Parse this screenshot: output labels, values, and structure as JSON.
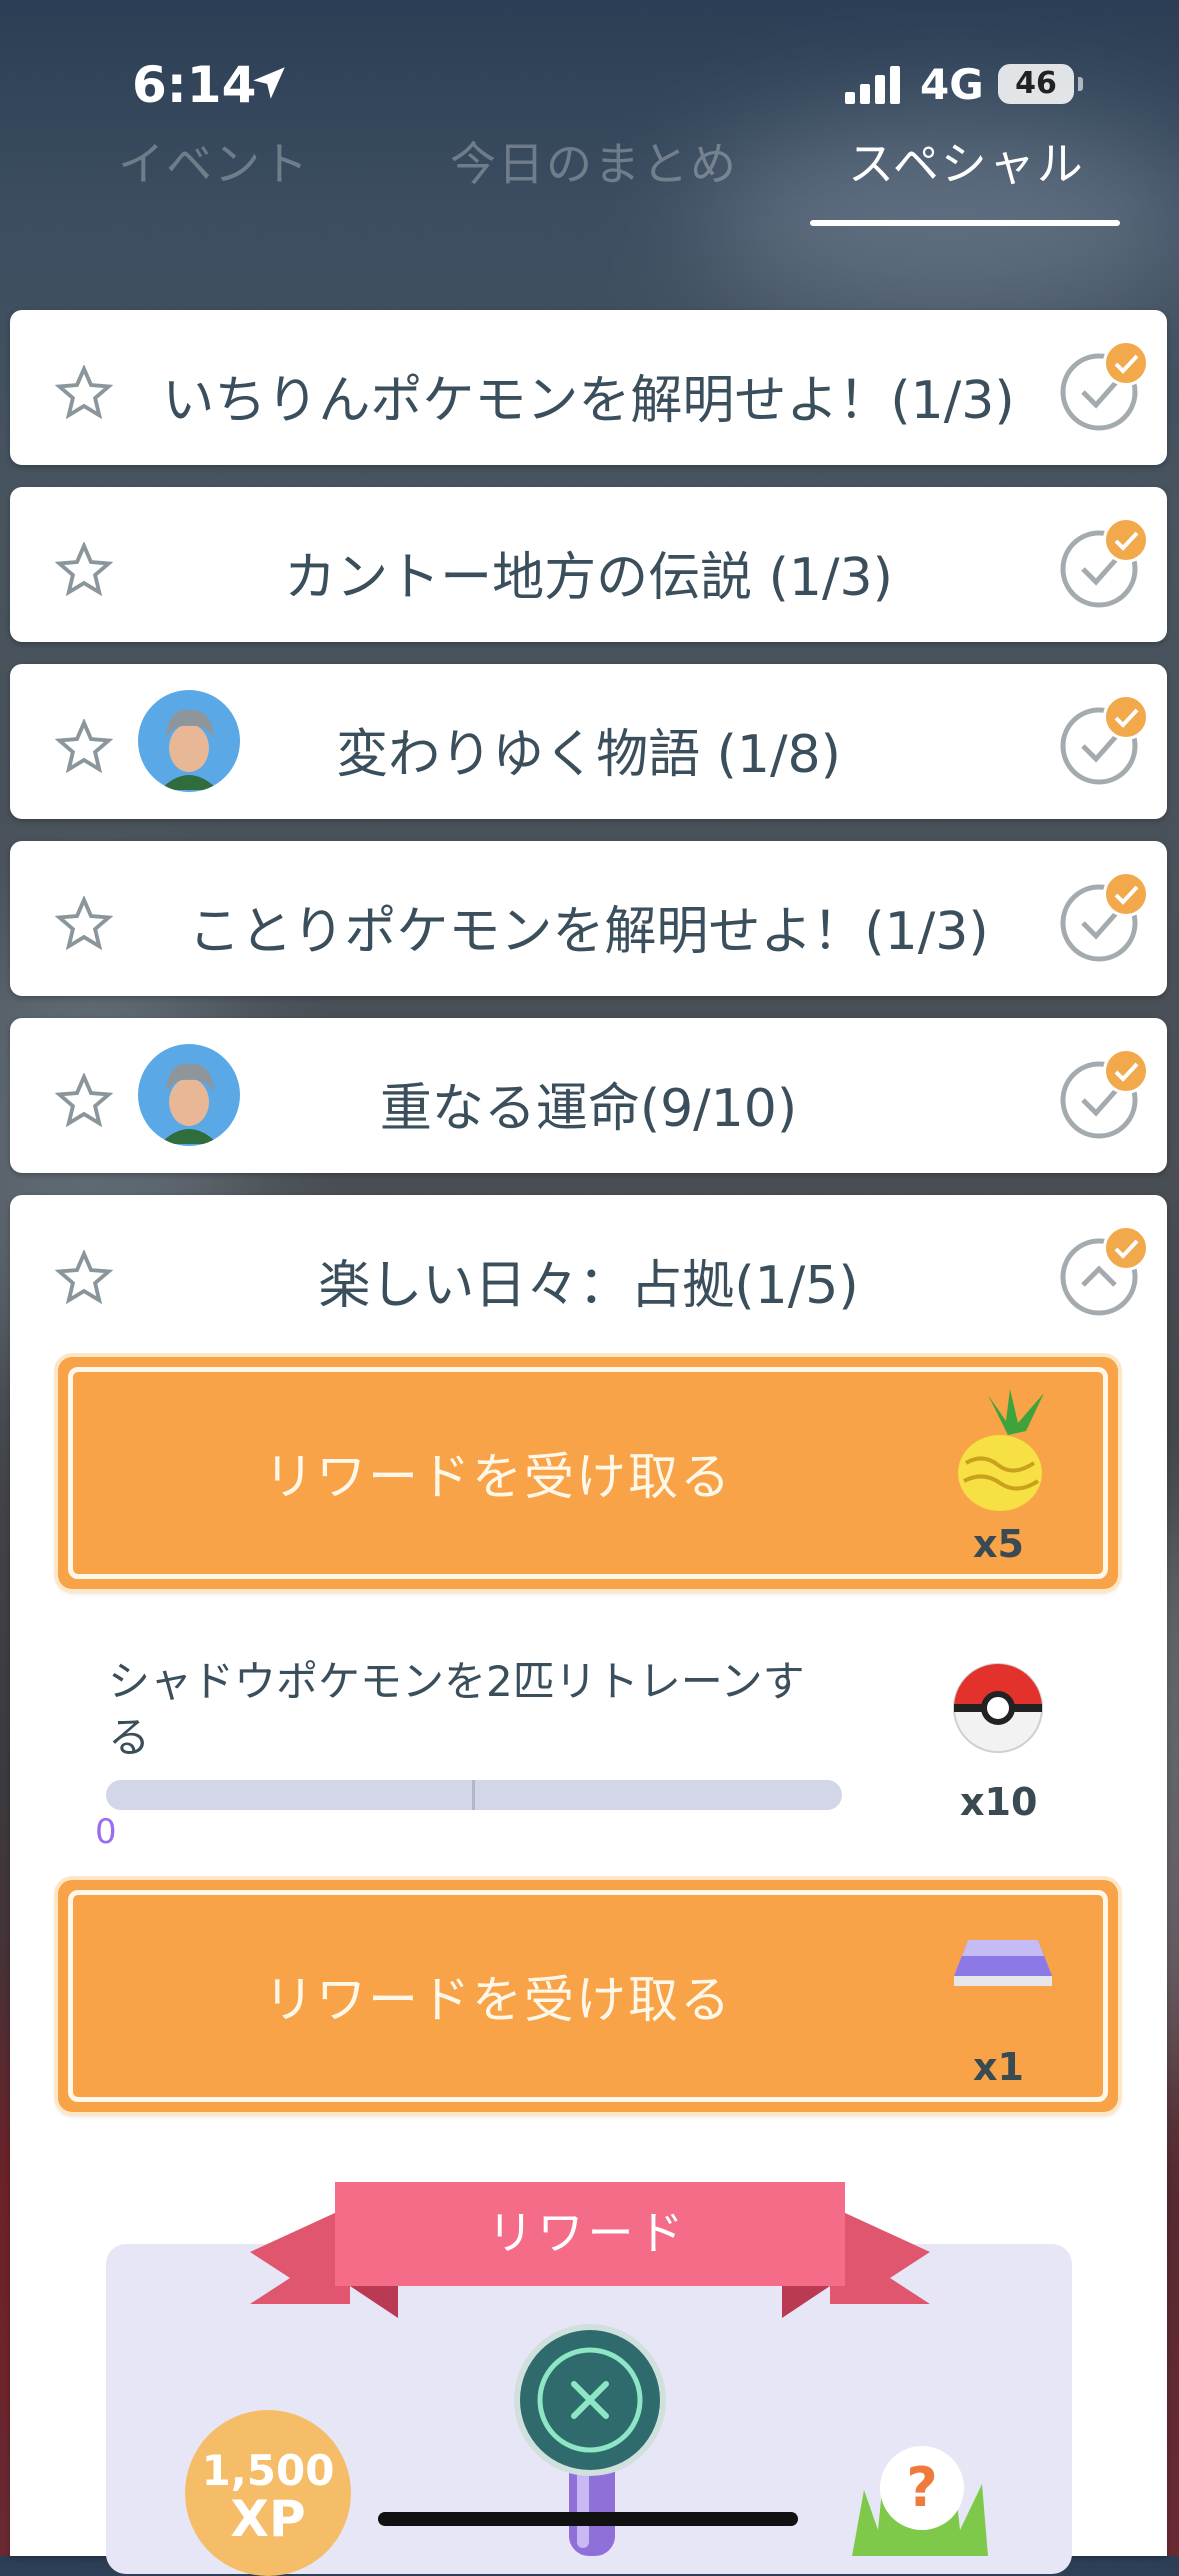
{
  "status_bar": {
    "time": "6:14",
    "network": "4G",
    "battery": "46"
  },
  "tabs": [
    {
      "label": "イベント",
      "active": false
    },
    {
      "label": "今日のまとめ",
      "active": false
    },
    {
      "label": "スペシャル",
      "active": true
    }
  ],
  "research": [
    {
      "title": "いちりんポケモンを解明せよ！(1/3)",
      "avatar": false
    },
    {
      "title": "カントー地方の伝説 (1/3)",
      "avatar": false
    },
    {
      "title": "変わりゆく物語 (1/8)",
      "avatar": true
    },
    {
      "title": "ことりポケモンを解明せよ！(1/3)",
      "avatar": false
    },
    {
      "title": "重なる運命(9/10)",
      "avatar": true
    }
  ],
  "expanded": {
    "title": "楽しい日々：占拠(1/5)",
    "claim_1": {
      "label": "リワードを受け取る",
      "item_icon": "golden-pinap-berry-icon",
      "qty": "x5"
    },
    "task": {
      "text": "シャドウポケモンを2匹リトレーンする",
      "progress_value": "0",
      "progress_fraction": 0,
      "reward_icon": "poke-ball-icon",
      "reward_qty": "x10"
    },
    "claim_2": {
      "label": "リワードを受け取る",
      "item_icon": "lure-module-icon",
      "qty": "x1"
    },
    "rewards_header": "リワード",
    "xp_amount": "1,500",
    "xp_unit": "XP",
    "mystery_reward": "?"
  },
  "colors": {
    "accent_orange": "#f8a348",
    "badge_orange": "#f2a94b",
    "ribbon_pink": "#f46c88",
    "text_slate": "#3a4f5b"
  }
}
